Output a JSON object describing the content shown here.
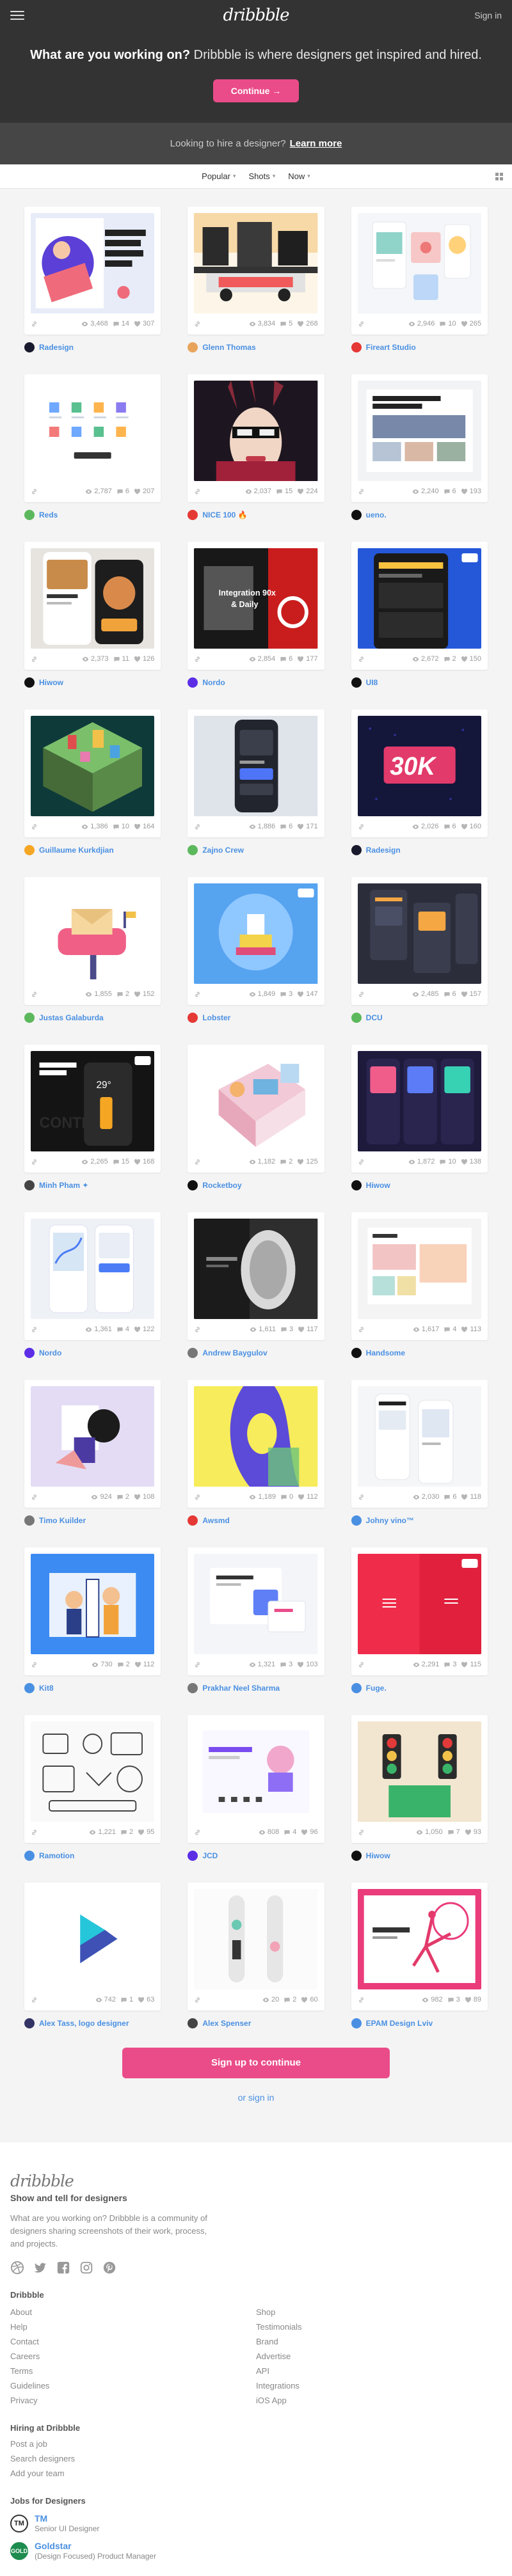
{
  "header": {
    "logo": "dribbble",
    "signin": "Sign in"
  },
  "hero": {
    "headline_bold": "What are you working on?",
    "headline_rest": " Dribbble is where designers get inspired and hired.",
    "cta": "Continue →"
  },
  "hire": {
    "text": "Looking to hire a designer?",
    "link": "Learn more"
  },
  "filters": {
    "sort": "Popular",
    "type": "Shots",
    "time": "Now"
  },
  "shots": [
    {
      "views": "3,468",
      "comments": "14",
      "likes": "307",
      "author": "Radesign",
      "theme": "illustration",
      "avatar_color": "#1a1a2e"
    },
    {
      "views": "3,834",
      "comments": "5",
      "likes": "268",
      "author": "Glenn Thomas",
      "theme": "scene",
      "avatar_color": "#e8a45c"
    },
    {
      "views": "2,946",
      "comments": "10",
      "likes": "265",
      "author": "Fireart Studio",
      "theme": "pastel",
      "avatar_color": "#e53935"
    },
    {
      "views": "2,787",
      "comments": "6",
      "likes": "207",
      "author": "Reds",
      "theme": "iso",
      "avatar_color": "#5cb85c"
    },
    {
      "views": "2,037",
      "comments": "15",
      "likes": "224",
      "author": "NICE 100 🔥",
      "theme": "portrait",
      "avatar_color": "#e53935"
    },
    {
      "views": "2,240",
      "comments": "6",
      "likes": "193",
      "author": "ueno.",
      "theme": "web",
      "avatar_color": "#111111"
    },
    {
      "views": "2,373",
      "comments": "11",
      "likes": "126",
      "author": "Hiwow",
      "theme": "food",
      "avatar_color": "#111111"
    },
    {
      "views": "2,854",
      "comments": "6",
      "likes": "177",
      "author": "Nordo",
      "theme": "promo",
      "avatar_color": "#5b2ee6"
    },
    {
      "views": "2,672",
      "comments": "2",
      "likes": "150",
      "author": "UI8",
      "theme": "ui8",
      "avatar_color": "#111111"
    },
    {
      "views": "1,386",
      "comments": "10",
      "likes": "164",
      "author": "Guillaume Kurkdjian",
      "theme": "city",
      "avatar_color": "#f5a623"
    },
    {
      "views": "1,886",
      "comments": "6",
      "likes": "171",
      "author": "Zajno Crew",
      "theme": "phone",
      "avatar_color": "#5cb85c"
    },
    {
      "views": "2,026",
      "comments": "6",
      "likes": "160",
      "author": "Radesign",
      "theme": "30k",
      "avatar_color": "#1a1a2e"
    },
    {
      "views": "1,855",
      "comments": "2",
      "likes": "152",
      "author": "Justas Galaburda",
      "theme": "mailbox",
      "avatar_color": "#5cb85c"
    },
    {
      "views": "1,849",
      "comments": "3",
      "likes": "147",
      "author": "Lobster",
      "theme": "ship",
      "avatar_color": "#e53935"
    },
    {
      "views": "2,485",
      "comments": "6",
      "likes": "157",
      "author": "DCU",
      "theme": "dash",
      "avatar_color": "#5cb85c"
    },
    {
      "views": "2,265",
      "comments": "15",
      "likes": "168",
      "author": "Minh Pham ✦",
      "theme": "control",
      "avatar_color": "#444444"
    },
    {
      "views": "1,182",
      "comments": "2",
      "likes": "125",
      "author": "Rocketboy",
      "theme": "room",
      "avatar_color": "#111111"
    },
    {
      "views": "1,872",
      "comments": "10",
      "likes": "138",
      "author": "Hiwow",
      "theme": "music",
      "avatar_color": "#111111"
    },
    {
      "views": "1,361",
      "comments": "4",
      "likes": "122",
      "author": "Nordo",
      "theme": "maps",
      "avatar_color": "#5b2ee6"
    },
    {
      "views": "1,611",
      "comments": "3",
      "likes": "117",
      "author": "Andrew Baygulov",
      "theme": "bw",
      "avatar_color": "#777777"
    },
    {
      "views": "1,617",
      "comments": "4",
      "likes": "113",
      "author": "Handsome",
      "theme": "shop",
      "avatar_color": "#111111"
    },
    {
      "views": "924",
      "comments": "2",
      "likes": "108",
      "author": "Timo Kuilder",
      "theme": "abstract",
      "avatar_color": "#777777"
    },
    {
      "views": "1,189",
      "comments": "0",
      "likes": "112",
      "author": "Awsmd",
      "theme": "face",
      "avatar_color": "#e53935"
    },
    {
      "views": "2,030",
      "comments": "6",
      "likes": "118",
      "author": "Johny vino™",
      "theme": "mobile",
      "avatar_color": "#4a90e2"
    },
    {
      "views": "730",
      "comments": "2",
      "likes": "112",
      "author": "Kit8",
      "theme": "workers",
      "avatar_color": "#4a90e2"
    },
    {
      "views": "1,321",
      "comments": "3",
      "likes": "103",
      "author": "Prakhar Neel Sharma",
      "theme": "webcard",
      "avatar_color": "#777777"
    },
    {
      "views": "2,291",
      "comments": "3",
      "likes": "115",
      "author": "Fuge.",
      "theme": "red",
      "avatar_color": "#4a90e2"
    },
    {
      "views": "1,221",
      "comments": "2",
      "likes": "95",
      "author": "Ramotion",
      "theme": "sketch",
      "avatar_color": "#4a90e2"
    },
    {
      "views": "808",
      "comments": "4",
      "likes": "96",
      "author": "JCD",
      "theme": "landing",
      "avatar_color": "#5b2ee6"
    },
    {
      "views": "1,050",
      "comments": "7",
      "likes": "93",
      "author": "Hiwow",
      "theme": "lights",
      "avatar_color": "#111111"
    },
    {
      "views": "742",
      "comments": "1",
      "likes": "63",
      "author": "Alex Tass, logo designer",
      "theme": "logo",
      "avatar_color": "#333366"
    },
    {
      "views": "20",
      "comments": "2",
      "likes": "60",
      "author": "Alex Spenser",
      "theme": "skate",
      "avatar_color": "#444444"
    },
    {
      "views": "982",
      "comments": "3",
      "likes": "89",
      "author": "EPAM Design Lviv",
      "theme": "yoga",
      "avatar_color": "#4a90e2"
    }
  ],
  "signup": {
    "button": "Sign up to continue",
    "alt": "or sign in"
  },
  "footer": {
    "logo": "dribbble",
    "tagline": "Show and tell for designers",
    "description": "What are you working on? Dribbble is a community of designers sharing screenshots of their work, process, and projects.",
    "section_title": "Dribbble",
    "links_left": [
      "About",
      "Help",
      "Contact",
      "Careers",
      "Terms",
      "Guidelines",
      "Privacy"
    ],
    "links_right": [
      "Shop",
      "Testimonials",
      "Brand",
      "Advertise",
      "API",
      "Integrations",
      "iOS App"
    ],
    "hiring_title": "Hiring at Dribbble",
    "hiring_links": [
      "Post a job",
      "Search designers",
      "Add your team"
    ],
    "jobs_title": "Jobs for Designers",
    "jobs": [
      {
        "logo": "TM",
        "company": "TM",
        "role": "Senior UI Designer"
      },
      {
        "logo": "GOLD",
        "company": "Goldstar",
        "role": "(Design Focused) Product Manager"
      }
    ]
  },
  "colors": {
    "brand": "#ea4c89",
    "link": "#4a90e2",
    "dark": "#333333"
  }
}
